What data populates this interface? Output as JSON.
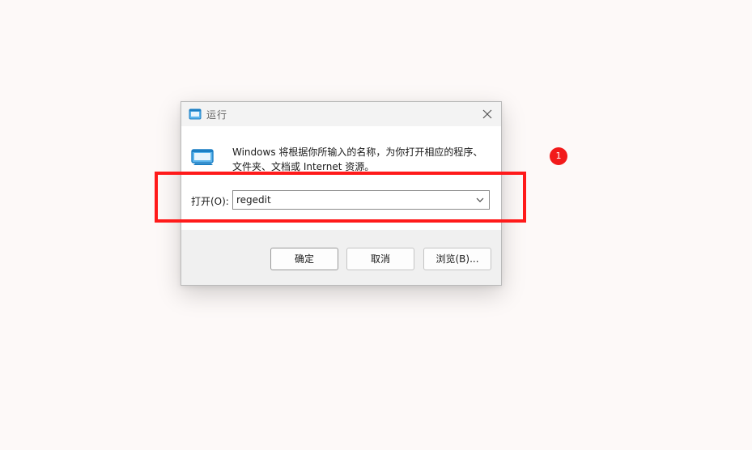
{
  "dialog": {
    "title": "运行",
    "description": "Windows 将根据你所输入的名称，为你打开相应的程序、文件夹、文档或 Internet 资源。",
    "open_label": "打开(O):",
    "command_value": "regedit",
    "buttons": {
      "ok": "确定",
      "cancel": "取消",
      "browse": "浏览(B)..."
    }
  },
  "annotation": {
    "step_number": "1",
    "highlight_color": "#ff1a1a"
  },
  "icons": {
    "title": "run-dialog-icon",
    "close": "close-icon",
    "dropdown": "chevron-down-icon",
    "app": "run-app-icon"
  },
  "colors": {
    "accent": "#1f8ed6",
    "badge": "#f21a1a"
  }
}
